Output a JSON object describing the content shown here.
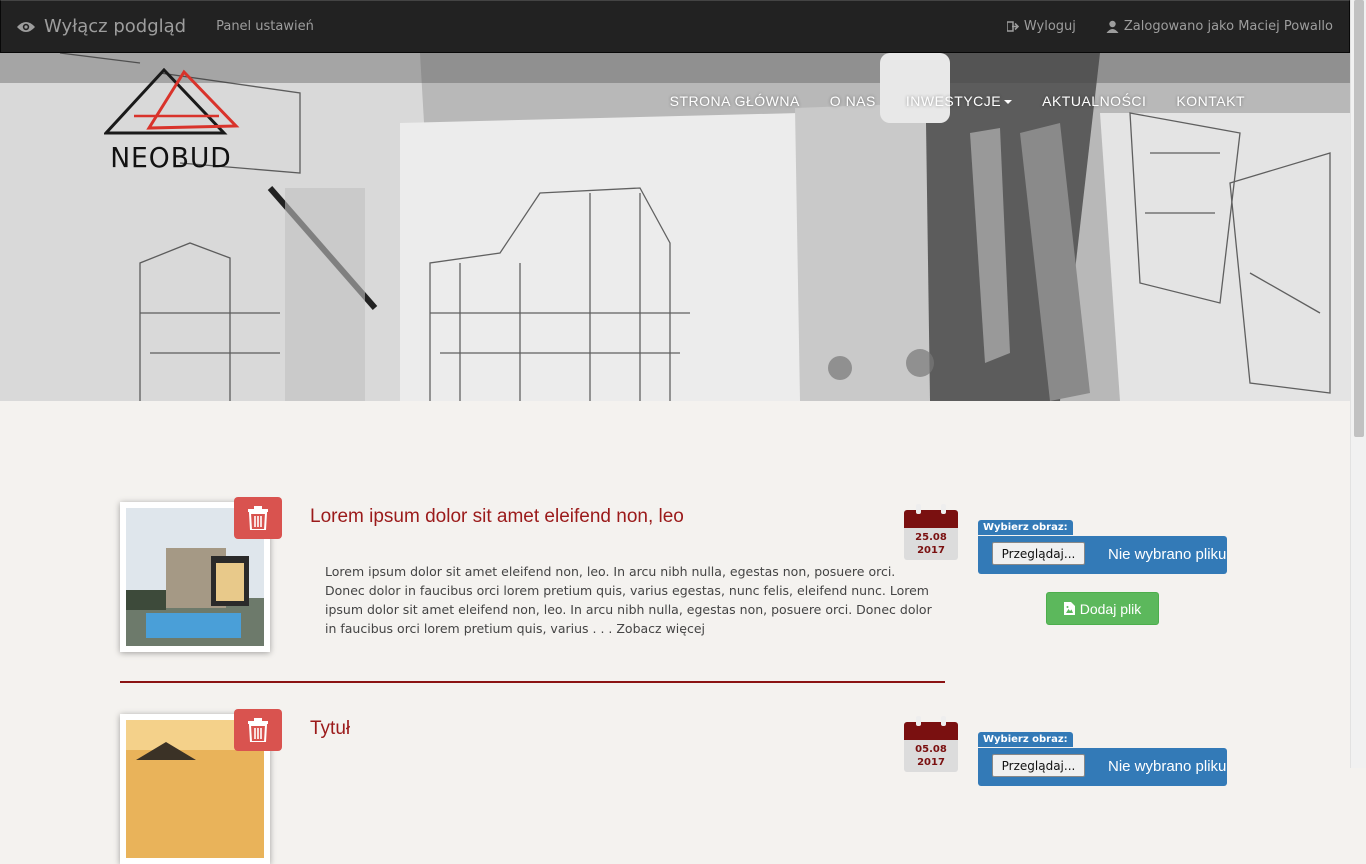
{
  "adminbar": {
    "preview_label": "Wyłącz podgląd",
    "panel_label": "Panel ustawień",
    "logout_label": "Wyloguj",
    "user_label": "Zalogowano jako Maciej Powallo"
  },
  "brand": {
    "logo_text": "NEOBUD",
    "accent": "#d9332b"
  },
  "nav": {
    "items": [
      "STRONA GŁÓWNA",
      "O NAS",
      "INWESTYCJE",
      "AKTUALNOŚCI",
      "KONTAKT"
    ]
  },
  "posts": [
    {
      "title": "Lorem ipsum dolor sit amet eleifend non, leo",
      "body": "Lorem ipsum dolor sit amet eleifend non, leo. In arcu nibh nulla, egestas non, posuere orci. Donec dolor in faucibus orci lorem pretium quis, varius egestas, nunc felis, eleifend nunc. Lorem ipsum dolor sit amet eleifend non, leo. In arcu nibh nulla, egestas non, posuere orci. Donec dolor in faucibus orci lorem pretium quis, varius . . .",
      "more": "Zobacz więcej",
      "date_day": "25.08",
      "date_year": "2017",
      "upload_label": "Wybierz obraz:",
      "browse_label": "Przeglądaj...",
      "nofile_label": "Nie wybrano pliku.",
      "add_label": "Dodaj plik"
    },
    {
      "title": "Tytuł",
      "date_day": "05.08",
      "date_year": "2017",
      "upload_label": "Wybierz obraz:",
      "browse_label": "Przeglądaj...",
      "nofile_label": "Nie wybrano pliku."
    }
  ],
  "colors": {
    "title": "#9b1a1a",
    "danger": "#d9534f",
    "success": "#5cb85c",
    "primary": "#337ab7"
  }
}
